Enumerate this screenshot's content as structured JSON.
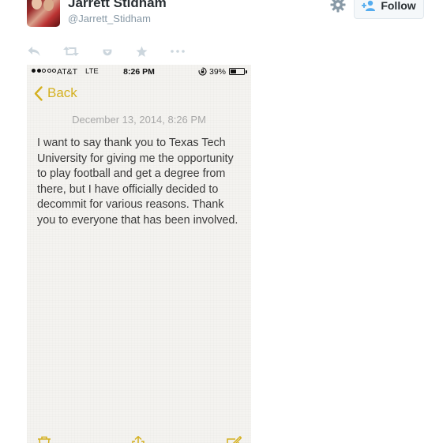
{
  "tweet": {
    "display_name": "Jarrett Stidham",
    "screen_name": "@Jarrett_Stidham",
    "follow_label": "Follow",
    "actions": [
      "reply-icon",
      "retweet-icon",
      "favorite-icon",
      "star-icon",
      "more-icon"
    ]
  },
  "phone": {
    "status_bar": {
      "carrier": "AT&T",
      "network": "LTE",
      "time": "8:26 PM",
      "battery": "39%",
      "battery_level": 0.39,
      "signal_bars": 2
    },
    "back_label": "Back",
    "note": {
      "date": "December 13, 2014, 8:26 PM",
      "body": "I want to say thank you to Texas Tech University for giving me the opportunity to play football and get a degree from there, but I have officially decided to decommit for various reasons. Thank you to everyone that has been involved."
    },
    "toolbar": [
      "trash-icon",
      "share-icon",
      "compose-icon"
    ]
  },
  "colors": {
    "accent_yellow": "#d4b01f",
    "note_background": "#f4f3f0",
    "muted_text": "#8899a6"
  }
}
